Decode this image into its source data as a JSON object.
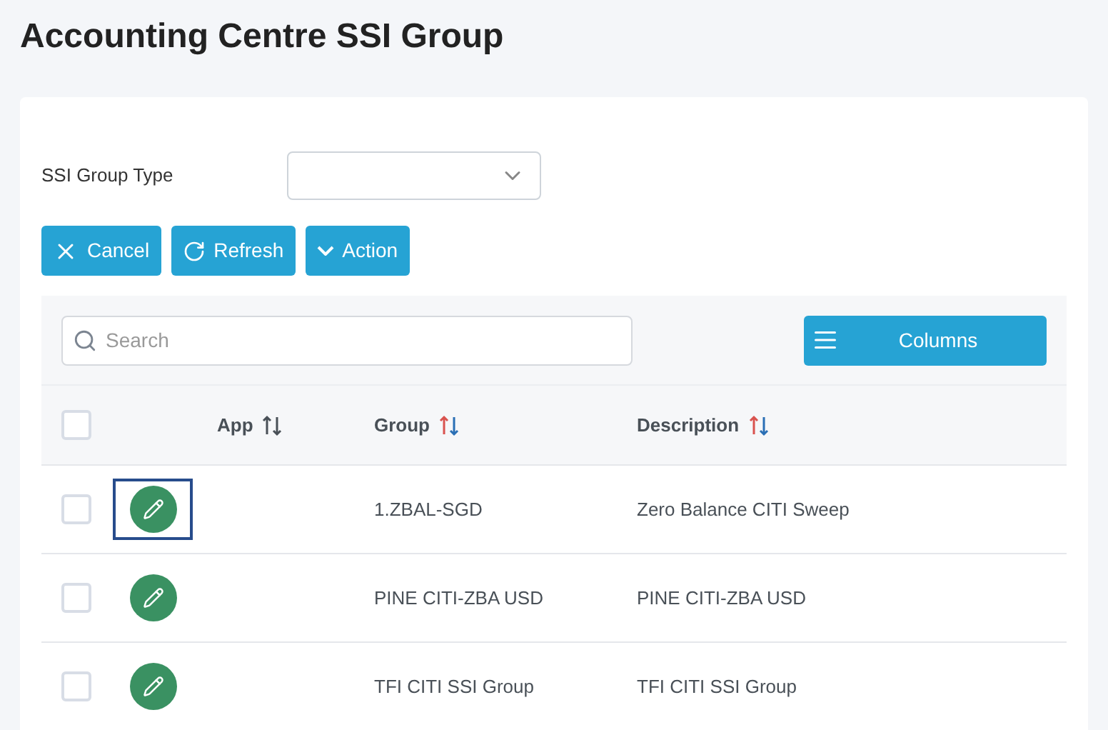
{
  "title": "Accounting Centre SSI Group",
  "filter": {
    "label": "SSI Group Type"
  },
  "buttons": [
    {
      "label": "Cancel",
      "kind": "cancel"
    },
    {
      "label": "Refresh",
      "kind": "refresh"
    },
    {
      "label": "Action",
      "kind": "action"
    }
  ],
  "search": {
    "placeholder": "Search"
  },
  "columns_button": {
    "label": "Columns"
  },
  "table": {
    "select_all": {
      "checked": false
    },
    "columns": [
      {
        "label": "App",
        "sorted": false
      },
      {
        "label": "Group",
        "sorted": true
      },
      {
        "label": "Description",
        "sorted": true
      }
    ],
    "rows": [
      {
        "checked": false,
        "focused": true,
        "group": "1.ZBAL-SGD",
        "description": "Zero Balance CITI Sweep"
      },
      {
        "checked": false,
        "focused": false,
        "group": "PINE CITI-ZBA USD",
        "description": "PINE CITI-ZBA USD"
      },
      {
        "checked": false,
        "focused": false,
        "group": "TFI CITI SSI Group",
        "description": "TFI CITI SSI Group"
      }
    ]
  }
}
